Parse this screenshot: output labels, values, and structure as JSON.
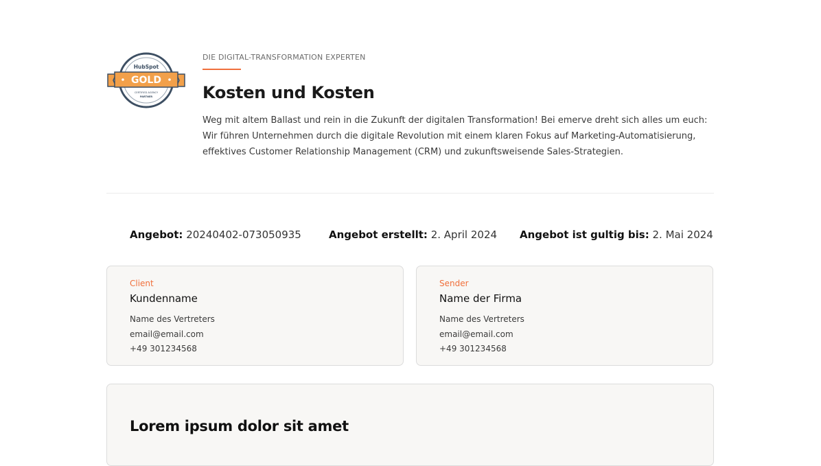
{
  "badge": {
    "brand": "HubSpot",
    "level": "GOLD",
    "line1": "CERTIFIED AGENCY",
    "line2": "PARTNER"
  },
  "header": {
    "eyebrow": "DIE DIGITAL-TRANSFORMATION EXPERTEN",
    "title": "Kosten und Kosten",
    "intro": "Weg mit altem Ballast und rein in die Zukunft der digitalen Transformation! Bei emerve dreht sich alles um euch: Wir führen Unternehmen durch die digitale Revolution mit einem klaren Fokus auf Marketing-Automatisierung, effektives Customer Relationship Management (CRM) und zukunftsweisende Sales-Strategien."
  },
  "meta": {
    "offer_label": "Angebot:",
    "offer_value": "20240402-073050935",
    "created_label": "Angebot erstellt:",
    "created_value": "2. April 2024",
    "valid_label": "Angebot ist gultig bis:",
    "valid_value": "2. Mai 2024"
  },
  "client": {
    "tag": "Client",
    "name": "Kundenname",
    "rep": "Name des Vertreters",
    "email": "email@email.com",
    "phone": "+49 301234568"
  },
  "sender": {
    "tag": "Sender",
    "name": "Name der Firma",
    "rep": "Name des Vertreters",
    "email": "email@email.com",
    "phone": "+49 301234568"
  },
  "section": {
    "heading": "Lorem ipsum dolor sit amet"
  },
  "colors": {
    "accent": "#f06f3b",
    "badge_gold": "#f2a04a",
    "badge_ring": "#3d4f63"
  }
}
